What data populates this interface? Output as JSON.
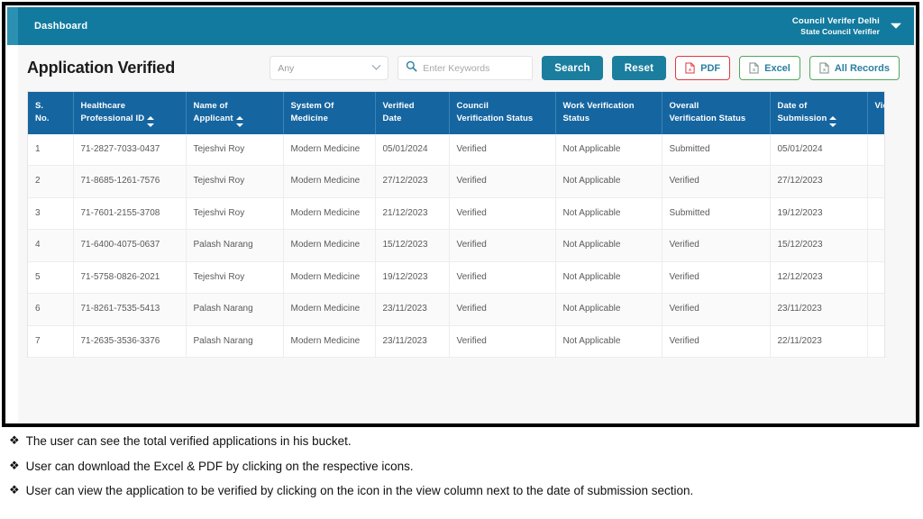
{
  "topbar": {
    "title": "Dashboard",
    "user_name": "Council Verifer Delhi",
    "user_role": "State Council Verifier",
    "caret_icon": "chevron-down-icon"
  },
  "toolbar": {
    "page_title": "Application Verified",
    "filter_value": "Any",
    "search_placeholder": "Enter Keywords",
    "search_value": "",
    "search_icon": "search-icon",
    "search_label": "Search",
    "reset_label": "Reset",
    "pdf_label": "PDF",
    "excel_label": "Excel",
    "all_records_label": "All Records",
    "pdf_icon": "pdf-file-icon",
    "excel_icon": "excel-file-icon",
    "all_records_icon": "excel-file-icon",
    "colors": {
      "topbar": "#127a9e",
      "table_header": "#1565a0",
      "primary_button": "#1b7e9e",
      "pdf_border": "#e0393e",
      "excel_border": "#4fa85c",
      "link_text": "#2a7fa0"
    }
  },
  "table": {
    "columns": [
      {
        "label_line1": "S.",
        "label_line2": "No.",
        "sortable": false
      },
      {
        "label_line1": "Healthcare",
        "label_line2": "Professional ID",
        "sortable": true
      },
      {
        "label_line1": "Name of",
        "label_line2": "Applicant",
        "sortable": true
      },
      {
        "label_line1": "System Of",
        "label_line2": "Medicine",
        "sortable": false
      },
      {
        "label_line1": "Verified",
        "label_line2": "Date",
        "sortable": false
      },
      {
        "label_line1": "Council",
        "label_line2": "Verification Status",
        "sortable": false
      },
      {
        "label_line1": "Work Verification",
        "label_line2": "Status",
        "sortable": false
      },
      {
        "label_line1": "Overall",
        "label_line2": "Verification Status",
        "sortable": false
      },
      {
        "label_line1": "Date of",
        "label_line2": "Submission",
        "sortable": true
      },
      {
        "label_line1": "View",
        "label_line2": "",
        "sortable": false
      }
    ],
    "rows": [
      {
        "sno": "1",
        "hpid": "71-2827-7033-0437",
        "applicant": "Tejeshvi Roy",
        "system": "Modern Medicine",
        "verified_date": "05/01/2024",
        "council_status": "Verified",
        "work_status": "Not Applicable",
        "overall_status": "Submitted",
        "submission_date": "05/01/2024",
        "view_icon": "eye-icon"
      },
      {
        "sno": "2",
        "hpid": "71-8685-1261-7576",
        "applicant": "Tejeshvi Roy",
        "system": "Modern Medicine",
        "verified_date": "27/12/2023",
        "council_status": "Verified",
        "work_status": "Not Applicable",
        "overall_status": "Verified",
        "submission_date": "27/12/2023",
        "view_icon": "eye-icon"
      },
      {
        "sno": "3",
        "hpid": "71-7601-2155-3708",
        "applicant": "Tejeshvi Roy",
        "system": "Modern Medicine",
        "verified_date": "21/12/2023",
        "council_status": "Verified",
        "work_status": "Not Applicable",
        "overall_status": "Submitted",
        "submission_date": "19/12/2023",
        "view_icon": "eye-icon"
      },
      {
        "sno": "4",
        "hpid": "71-6400-4075-0637",
        "applicant": "Palash Narang",
        "system": "Modern Medicine",
        "verified_date": "15/12/2023",
        "council_status": "Verified",
        "work_status": "Not Applicable",
        "overall_status": "Verified",
        "submission_date": "15/12/2023",
        "view_icon": "eye-icon"
      },
      {
        "sno": "5",
        "hpid": "71-5758-0826-2021",
        "applicant": "Tejeshvi Roy",
        "system": "Modern Medicine",
        "verified_date": "19/12/2023",
        "council_status": "Verified",
        "work_status": "Not Applicable",
        "overall_status": "Verified",
        "submission_date": "12/12/2023",
        "view_icon": "eye-icon"
      },
      {
        "sno": "6",
        "hpid": "71-8261-7535-5413",
        "applicant": "Palash Narang",
        "system": "Modern Medicine",
        "verified_date": "23/11/2023",
        "council_status": "Verified",
        "work_status": "Not Applicable",
        "overall_status": "Verified",
        "submission_date": "23/11/2023",
        "view_icon": "eye-icon"
      },
      {
        "sno": "7",
        "hpid": "71-2635-3536-3376",
        "applicant": "Palash Narang",
        "system": "Modern Medicine",
        "verified_date": "23/11/2023",
        "council_status": "Verified",
        "work_status": "Not Applicable",
        "overall_status": "Verified",
        "submission_date": "22/11/2023",
        "view_icon": "eye-icon"
      }
    ]
  },
  "notes": {
    "bullet_glyph": "❖",
    "items": [
      "The user can see the total verified applications in his bucket.",
      "User can download the Excel & PDF by clicking on the respective icons.",
      "User can view the application to be verified by clicking on the icon in the view column next to the date of submission section."
    ]
  }
}
